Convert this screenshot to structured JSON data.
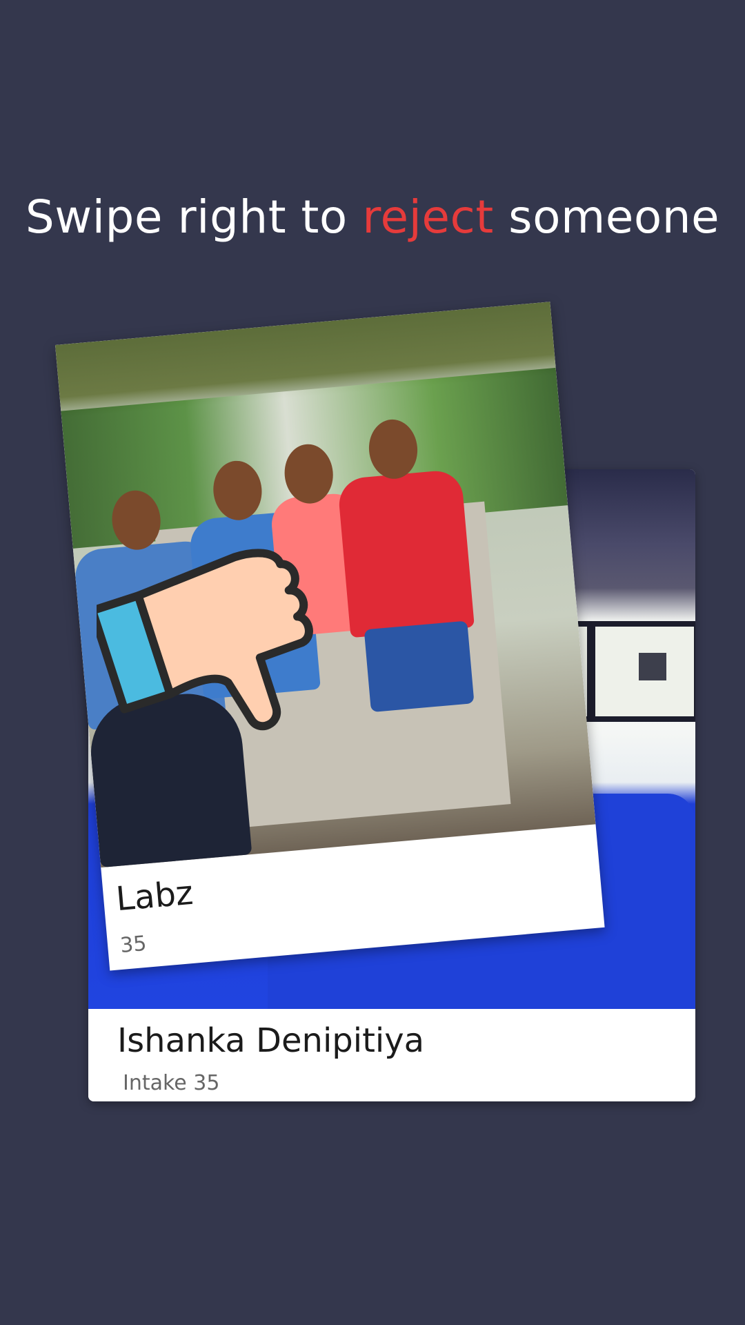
{
  "headline": {
    "part1": "Swipe right to ",
    "accent": "reject",
    "part2": " someone",
    "accent_color": "#e63b3b"
  },
  "cards": {
    "front": {
      "name": "Labz",
      "meta": "35"
    },
    "back": {
      "name": "Ishanka Denipitiya",
      "meta": "Intake 35"
    }
  },
  "icons": {
    "reject": "thumbs-down-icon"
  },
  "colors": {
    "background": "#34374d",
    "thumb_fill": "#ffcfb0",
    "thumb_cuff": "#4bbbe0"
  }
}
